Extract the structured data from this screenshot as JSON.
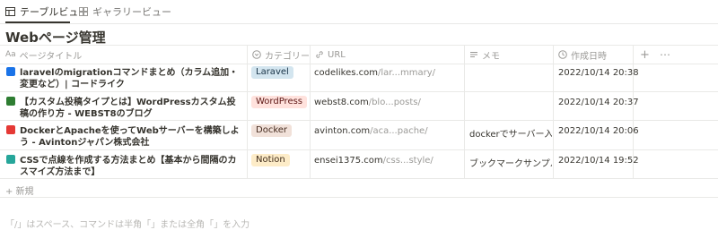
{
  "tabs": [
    {
      "label": "テーブルビュー",
      "icon": "table-icon",
      "active": true
    },
    {
      "label": "ギャラリービュー",
      "icon": "gallery-icon",
      "active": false
    }
  ],
  "page_title": "Webページ管理",
  "columns": [
    {
      "label": "ページタイトル",
      "icon": "title-icon"
    },
    {
      "label": "カテゴリー",
      "icon": "select-icon"
    },
    {
      "label": "URL",
      "icon": "url-link-icon"
    },
    {
      "label": "メモ",
      "icon": "text-lines-icon"
    },
    {
      "label": "作成日時",
      "icon": "clock-icon"
    }
  ],
  "add_column": "+",
  "more_columns": "⋯",
  "rows": [
    {
      "favicon_color": "#1a73e8",
      "title": "laravelのmigrationコマンドまとめ（カラム追加・変更など）| コードライク",
      "category": "Laravel",
      "category_bg": "#d3e5ef",
      "category_fg": "#183347",
      "url_main": "codelikes.com",
      "url_rest": "/lar...mmary/",
      "memo": "",
      "date": "2022/10/14 20:38"
    },
    {
      "favicon_color": "#2e7d32",
      "title": "【カスタム投稿タイプとは】WordPressカスタム投稿の作り方 - WEBST8のブログ",
      "category": "WordPress",
      "category_bg": "#ffe2dd",
      "category_fg": "#5d1715",
      "url_main": "webst8.com",
      "url_rest": "/blo...posts/",
      "memo": "",
      "date": "2022/10/14 20:37"
    },
    {
      "favicon_color": "#e53935",
      "title": "DockerとApacheを使ってWebサーバーを構築しよう - Avintonジャパン株式会社",
      "category": "Docker",
      "category_bg": "#f1e1d9",
      "category_fg": "#442a1e",
      "url_main": "avinton.com",
      "url_rest": "/aca...pache/",
      "memo": "dockerでサーバー入る",
      "date": "2022/10/14 20:06"
    },
    {
      "favicon_color": "#26a69a",
      "title": "CSSで点線を作成する方法まとめ【基本から間隔のカスマイズ方法まで】",
      "category": "Notion",
      "category_bg": "#fdecc8",
      "category_fg": "#402c1b",
      "url_main": "ensei1375.com",
      "url_rest": "/css...style/",
      "memo": "ブックマークサンプル",
      "date": "2022/10/14 19:52"
    }
  ],
  "new_row_label": "+ 新規",
  "hint_text": "「/」はスペース、コマンドは半角「」または全角「」を入力"
}
